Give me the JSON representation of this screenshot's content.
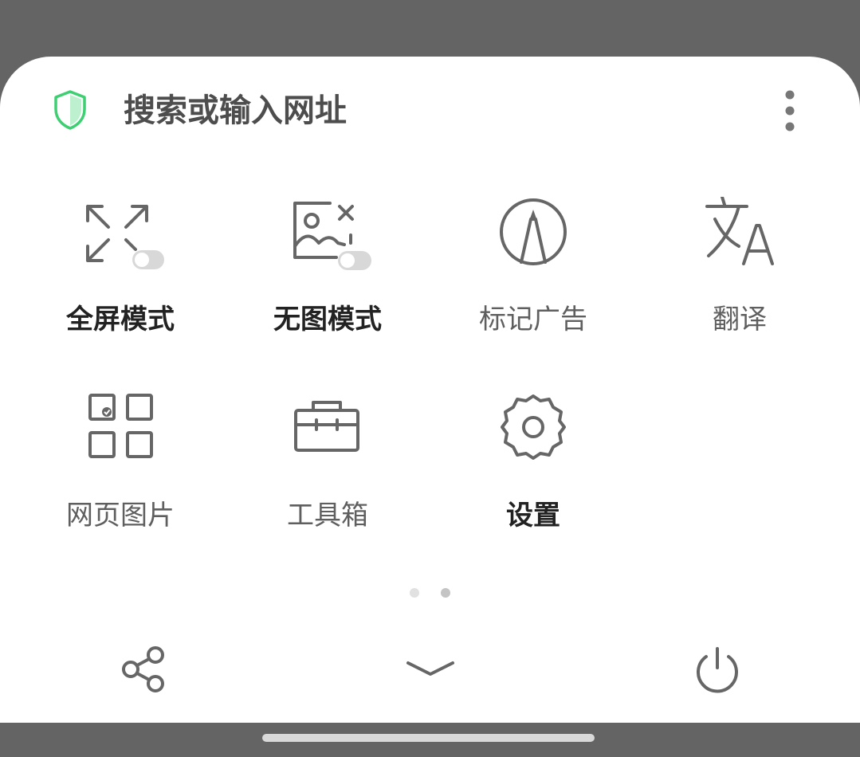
{
  "header": {
    "url_placeholder": "搜索或输入网址",
    "shield_icon": "shield-icon",
    "more_icon": "more-vertical-icon"
  },
  "menu": {
    "items": [
      {
        "label": "全屏模式",
        "icon": "fullscreen-toggle-icon"
      },
      {
        "label": "无图模式",
        "icon": "no-image-toggle-icon"
      },
      {
        "label": "标记广告",
        "icon": "mark-ad-icon"
      },
      {
        "label": "翻译",
        "icon": "translate-icon"
      },
      {
        "label": "网页图片",
        "icon": "web-images-icon"
      },
      {
        "label": "工具箱",
        "icon": "toolbox-icon"
      },
      {
        "label": "设置",
        "icon": "settings-icon"
      }
    ]
  },
  "pager": {
    "pages": 2,
    "active_page": 2
  },
  "bottom_bar": {
    "icons": [
      "share-icon",
      "collapse-icon",
      "power-icon"
    ]
  },
  "colors": {
    "shield_accent": "#3ecf72",
    "icon_gray": "#6b6b6b",
    "overlay": "#646464",
    "sheet": "#ffffff"
  }
}
